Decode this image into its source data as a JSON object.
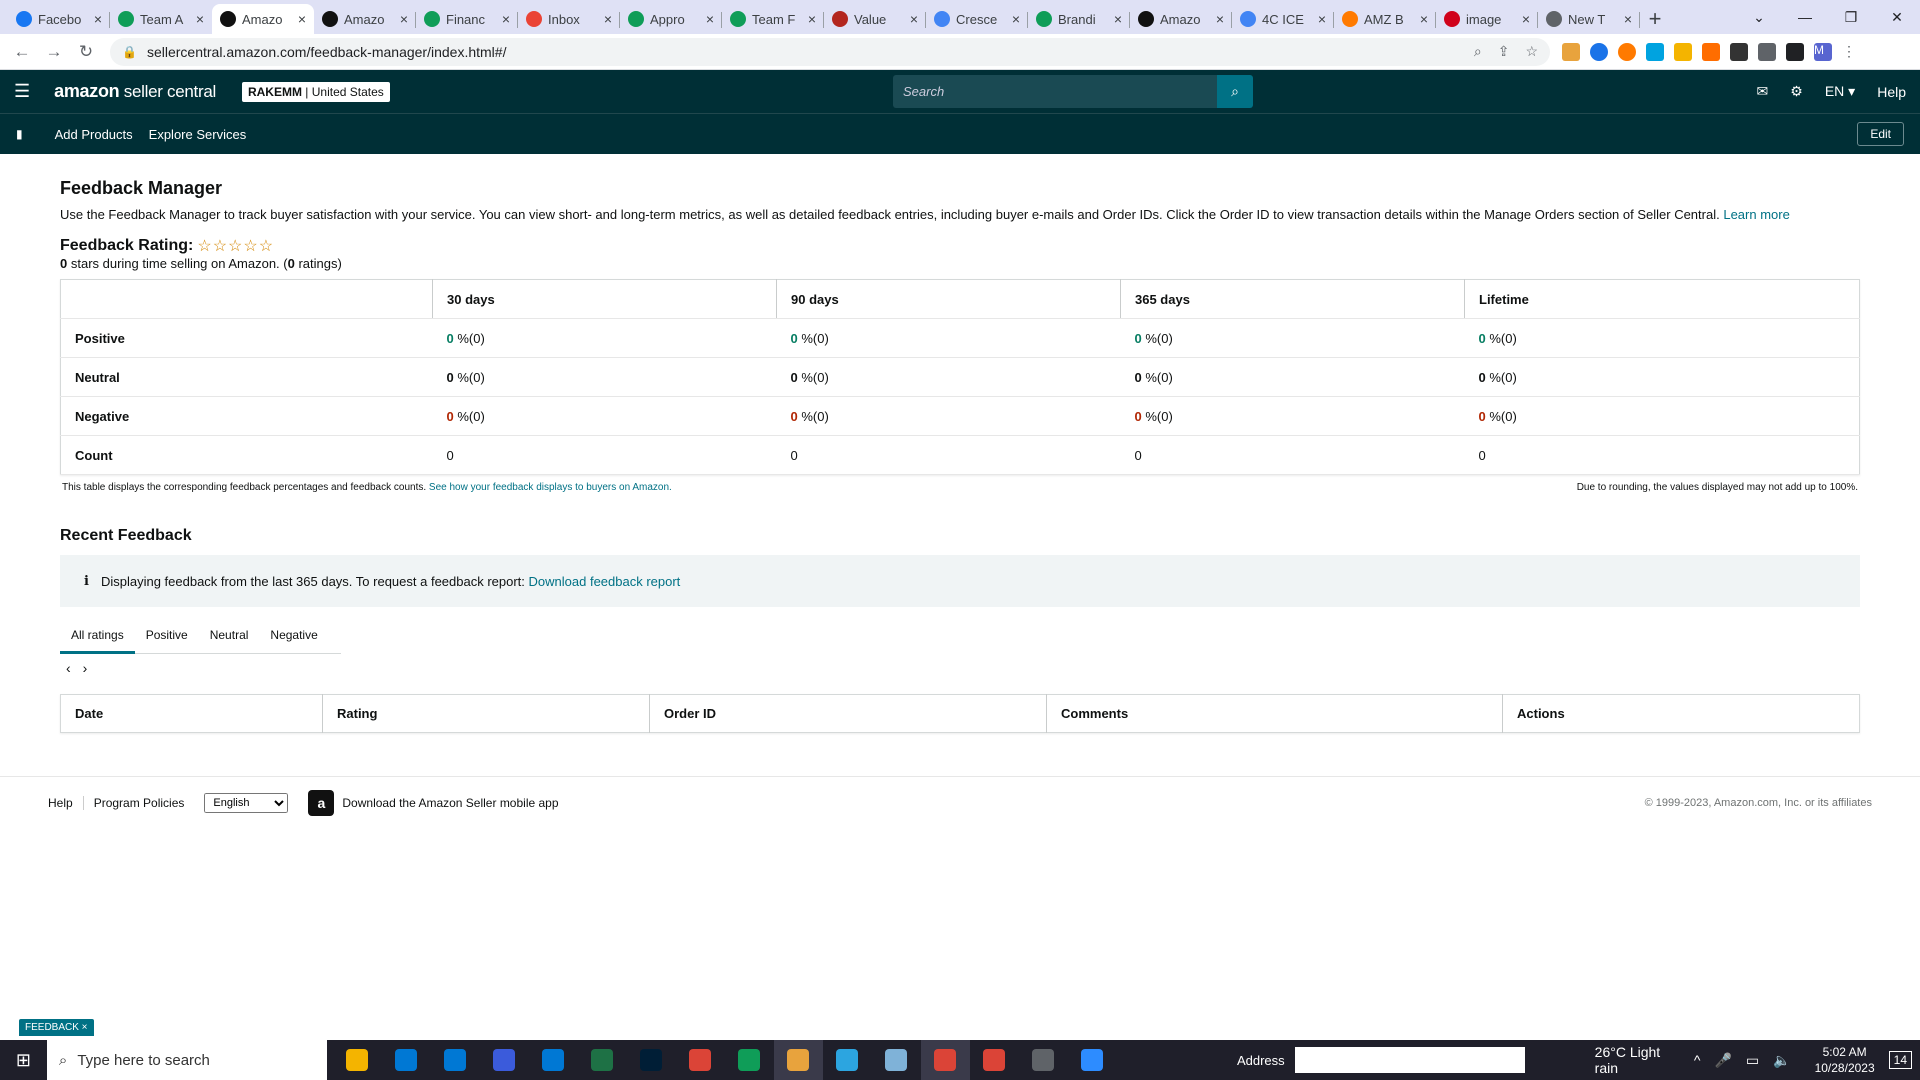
{
  "browser": {
    "tabs": [
      {
        "title": "Facebo",
        "color": "#1877f2"
      },
      {
        "title": "Team A",
        "color": "#0f9d58"
      },
      {
        "title": "Amazo",
        "color": "#111111"
      },
      {
        "title": "Amazo",
        "color": "#111111"
      },
      {
        "title": "Financ",
        "color": "#0f9d58"
      },
      {
        "title": "Inbox",
        "color": "#ea4335"
      },
      {
        "title": "Appro",
        "color": "#0f9d58"
      },
      {
        "title": "Team F",
        "color": "#0f9d58"
      },
      {
        "title": "Value",
        "color": "#b3261e"
      },
      {
        "title": "Cresce",
        "color": "#4285f4"
      },
      {
        "title": "Brandi",
        "color": "#0f9d58"
      },
      {
        "title": "Amazo",
        "color": "#111111"
      },
      {
        "title": "4C ICE",
        "color": "#4285f4"
      },
      {
        "title": "AMZ B",
        "color": "#ff7a00"
      },
      {
        "title": "image",
        "color": "#d0021b"
      },
      {
        "title": "New T",
        "color": "#5f6368"
      }
    ],
    "url": "sellercentral.amazon.com/feedback-manager/index.html#/"
  },
  "header": {
    "logo_main": "amazon",
    "logo_sub": " seller central",
    "store_name": "RAKEMM",
    "store_sep": " | ",
    "store_region": "United States",
    "search_placeholder": "Search",
    "lang": "EN ▾",
    "help": "Help"
  },
  "nav": {
    "add_products": "Add Products",
    "explore_services": "Explore Services",
    "edit": "Edit"
  },
  "page": {
    "title": "Feedback Manager",
    "description": "Use the Feedback Manager to track buyer satisfaction with your service. You can view short- and long-term metrics, as well as detailed feedback entries, including buyer e-mails and Order IDs. Click the Order ID to view transaction details within the Manage Orders section of Seller Central.",
    "learn_more": "Learn more",
    "rating_label": "Feedback Rating:",
    "stars": "☆☆☆☆☆",
    "stars_count": "0",
    "stars_text": " stars during time selling on Amazon. (",
    "ratings_count": "0",
    "ratings_text": " ratings)"
  },
  "feedback_table": {
    "columns": [
      "30 days",
      "90 days",
      "365 days",
      "Lifetime"
    ],
    "rows": [
      {
        "label": "Positive",
        "cells": [
          [
            "0",
            " %(0)"
          ],
          [
            "0",
            " %(0)"
          ],
          [
            "0",
            " %(0)"
          ],
          [
            "0",
            " %(0)"
          ]
        ]
      },
      {
        "label": "Neutral",
        "cells": [
          [
            "0",
            " %(0)"
          ],
          [
            "0",
            " %(0)"
          ],
          [
            "0",
            " %(0)"
          ],
          [
            "0",
            " %(0)"
          ]
        ]
      },
      {
        "label": "Negative",
        "cells": [
          [
            "0",
            " %(0)"
          ],
          [
            "0",
            " %(0)"
          ],
          [
            "0",
            " %(0)"
          ],
          [
            "0",
            " %(0)"
          ]
        ]
      },
      {
        "label": "Count",
        "cells": [
          [
            "0",
            ""
          ],
          [
            "0",
            ""
          ],
          [
            "0",
            ""
          ],
          [
            "0",
            ""
          ]
        ]
      }
    ],
    "note_left": "This table displays the corresponding feedback percentages and feedback counts.",
    "note_link": "See how your feedback displays to buyers on Amazon.",
    "note_right": "Due to rounding, the values displayed may not add up to 100%."
  },
  "recent": {
    "title": "Recent Feedback",
    "info_text": "Displaying feedback from the last 365 days. To request a feedback report:",
    "info_link": "Download feedback report",
    "tabs": [
      "All ratings",
      "Positive",
      "Neutral",
      "Negative"
    ],
    "columns": [
      "Date",
      "Rating",
      "Order ID",
      "Comments",
      "Actions"
    ]
  },
  "footer": {
    "help": "Help",
    "program_policies": "Program Policies",
    "language": "English",
    "app_link": "Download the Amazon Seller mobile app",
    "copyright": "© 1999-2023, Amazon.com, Inc. or its affiliates",
    "feedback_tab": "FEEDBACK ×"
  },
  "taskbar": {
    "search_placeholder": "Type here to search",
    "address_label": "Address",
    "weather": "26°C  Light rain",
    "time": "5:02 AM",
    "date": "10/28/2023",
    "notifications": "14",
    "app_colors": [
      "#f4b400",
      "#0078d4",
      "#0078d4",
      "#3b5bdb",
      "#0078d4",
      "#1e7145",
      "#001e36",
      "#db4437",
      "#0f9d58",
      "#e8a33d",
      "#2ca5e0",
      "#7fb2d8",
      "#db4437",
      "#db4437",
      "#5f6368",
      "#2d8cff"
    ]
  }
}
